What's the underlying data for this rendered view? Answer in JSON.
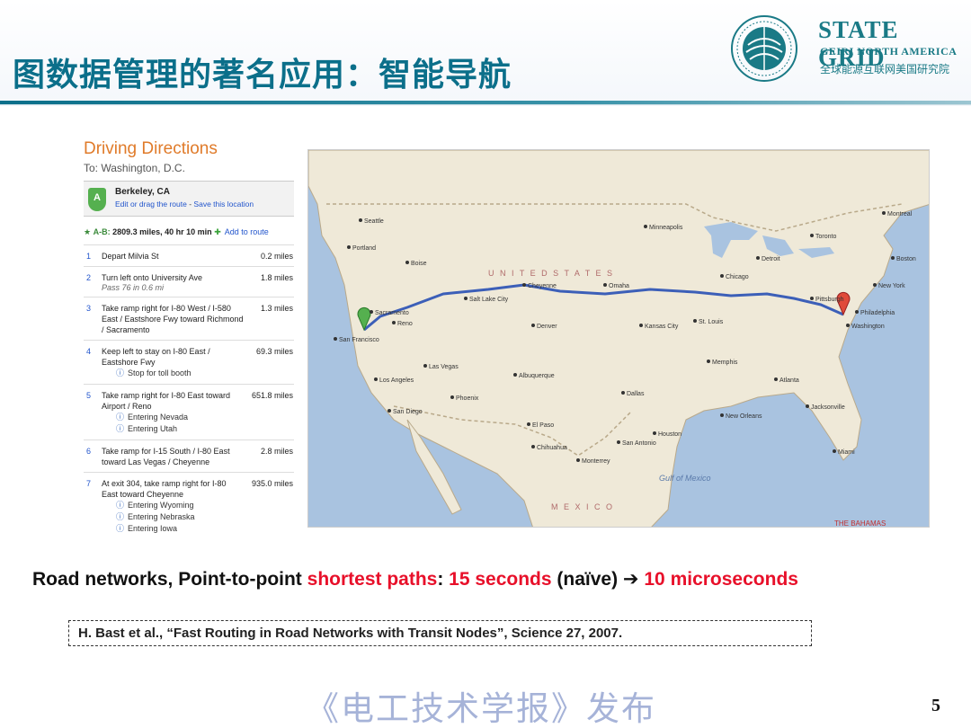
{
  "header": {
    "title": "图数据管理的著名应用：智能导航",
    "brand": {
      "name": "STATE GRID",
      "subtitle": "GEIRI NORTH AMERICA",
      "subtitle_cn": "全球能源互联网美国研究院"
    }
  },
  "directions": {
    "heading": "Driving Directions",
    "to": "To: Washington, D.C.",
    "start": {
      "pin": "A",
      "city": "Berkeley, CA",
      "edit_text": "Edit or drag the route",
      "edit_sep": " - ",
      "save_link": "Save this location"
    },
    "summary": {
      "ab": "A-B:",
      "text": "2809.3 miles, 40 hr 10 min",
      "add_route": "Add to route"
    },
    "steps": [
      {
        "num": "1",
        "text": "Depart Milvia St",
        "dist": "0.2 miles",
        "sub": []
      },
      {
        "num": "2",
        "text": "Turn left onto University Ave",
        "note": "Pass 76 in 0.6 mi",
        "dist": "1.8 miles",
        "sub": []
      },
      {
        "num": "3",
        "text": "Take ramp right for I-80 West / I-580 East / Eastshore Fwy toward Richmond / Sacramento",
        "dist": "1.3 miles",
        "sub": []
      },
      {
        "num": "4",
        "text": "Keep left to stay on I-80 East / Eastshore Fwy",
        "dist": "69.3 miles",
        "sub": [
          "Stop for toll booth"
        ]
      },
      {
        "num": "5",
        "text": "Take ramp right for I-80 East toward Airport / Reno",
        "dist": "651.8 miles",
        "sub": [
          "Entering Nevada",
          "Entering Utah"
        ]
      },
      {
        "num": "6",
        "text": "Take ramp for I-15 South / I-80 East toward Las Vegas / Cheyenne",
        "dist": "2.8 miles",
        "sub": []
      },
      {
        "num": "7",
        "text": "At exit 304, take ramp right for I-80 East toward Cheyenne",
        "dist": "935.0 miles",
        "sub": [
          "Entering Wyoming",
          "Entering Nebraska",
          "Entering Iowa"
        ]
      }
    ]
  },
  "map": {
    "country_label": "U N I T E D   S T A T E S",
    "mexico_label": "M E X I C O",
    "gulf_label": "Gulf of Mexico",
    "bahamas_label": "THE BAHAMAS",
    "colors": {
      "land": "#efe9d8",
      "water": "#a9c3e0",
      "route": "#3c5fb8",
      "border": "#b9a98a"
    },
    "cities": [
      {
        "name": "Seattle"
      },
      {
        "name": "Portland"
      },
      {
        "name": "Boise"
      },
      {
        "name": "Sacramento"
      },
      {
        "name": "San Francisco"
      },
      {
        "name": "Reno"
      },
      {
        "name": "Los Angeles"
      },
      {
        "name": "San Diego"
      },
      {
        "name": "Las Vegas"
      },
      {
        "name": "Salt Lake City"
      },
      {
        "name": "Phoenix"
      },
      {
        "name": "Denver"
      },
      {
        "name": "Cheyenne"
      },
      {
        "name": "Albuquerque"
      },
      {
        "name": "El Paso"
      },
      {
        "name": "Omaha"
      },
      {
        "name": "Kansas City"
      },
      {
        "name": "Dallas"
      },
      {
        "name": "Houston"
      },
      {
        "name": "San Antonio"
      },
      {
        "name": "Minneapolis"
      },
      {
        "name": "Chicago"
      },
      {
        "name": "St. Louis"
      },
      {
        "name": "Memphis"
      },
      {
        "name": "New Orleans"
      },
      {
        "name": "Atlanta"
      },
      {
        "name": "Detroit"
      },
      {
        "name": "Toronto"
      },
      {
        "name": "Pittsburgh"
      },
      {
        "name": "Philadelphia"
      },
      {
        "name": "Washington"
      },
      {
        "name": "New York"
      },
      {
        "name": "Boston"
      },
      {
        "name": "Montreal"
      },
      {
        "name": "Jacksonville"
      },
      {
        "name": "Miami"
      },
      {
        "name": "Monterrey"
      },
      {
        "name": "Chihuahua"
      }
    ]
  },
  "caption": {
    "part1": "Road networks, Point-to-point ",
    "part2": "shortest paths",
    "part3": ": ",
    "part4": "15 seconds",
    "part5": " (naïve)  ➔  ",
    "part6": "10 microseconds"
  },
  "reference": "H. Bast et al., “Fast Routing in Road Networks with Transit Nodes”, Science 27, 2007.",
  "watermark": "《电工技术学报》发布",
  "page_number": "5"
}
